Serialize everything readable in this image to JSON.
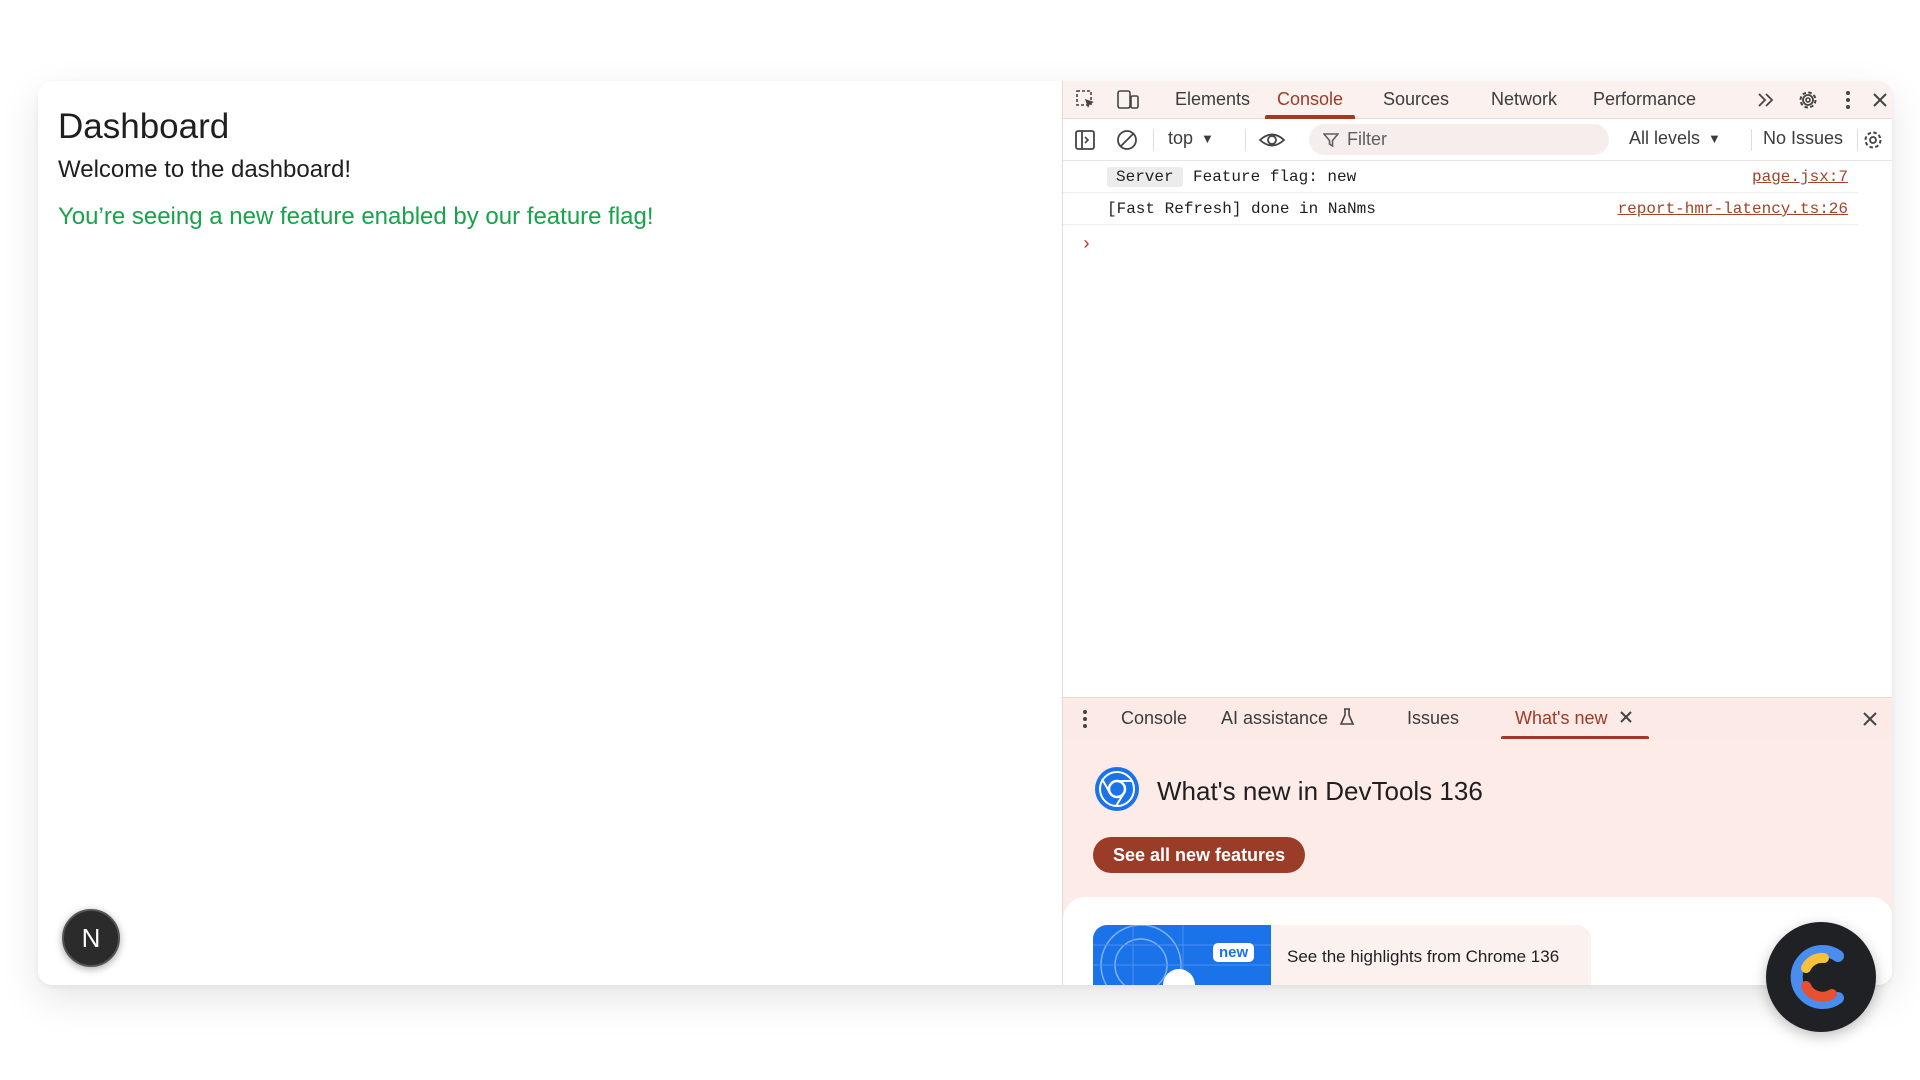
{
  "page": {
    "title": "Dashboard",
    "welcome": "Welcome to the dashboard!",
    "feature_message": "You’re seeing a new feature enabled by our feature flag!",
    "next_badge": "N"
  },
  "devtools": {
    "tabs": [
      "Elements",
      "Console",
      "Sources",
      "Network",
      "Performance"
    ],
    "active_tab": "Console",
    "toolbar": {
      "context": "top",
      "filter_placeholder": "Filter",
      "levels": "All levels",
      "issues": "No Issues"
    },
    "console": {
      "rows": [
        {
          "badge": "Server",
          "message": "Feature flag: new",
          "source": "page.jsx:7"
        },
        {
          "badge": "",
          "message": "[Fast Refresh] done in NaNms",
          "source": "report-hmr-latency.ts:26"
        }
      ],
      "prompt": "›"
    },
    "drawer": {
      "tabs": [
        "Console",
        "AI assistance",
        "Issues",
        "What's new"
      ],
      "active_tab": "What's new"
    },
    "whats_new": {
      "title": "What's new in DevTools 136",
      "button": "See all new features",
      "card_badge": "new",
      "card_text": "See the highlights from Chrome 136"
    }
  },
  "colors": {
    "accent": "#a03a24",
    "feature_green": "#17a34a",
    "whats_new_bg": "#fdebe7"
  }
}
